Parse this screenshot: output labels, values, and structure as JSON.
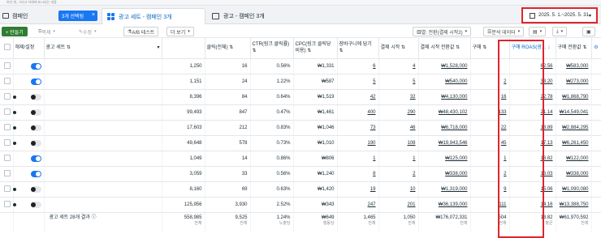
{
  "top_strip": "여기 위, 그리고 아래에 표시되는 내용",
  "tabs": {
    "campaign": "캠페인",
    "selected_chip": "3개 선택됨",
    "adset": "광고 세트 - 캠페인 3개",
    "ad": "광고 - 캠페인 3개"
  },
  "date_range": "2025. 5. 1.~2025. 5. 31.",
  "toolbar": {
    "create": "+ 만들기",
    "duplicate": "복제",
    "edit": "수정",
    "ab_test": "A/B 테스트",
    "more": "더 보기",
    "columns": "열: 전환(결제 시작2)",
    "breakdown": "분석 데이터"
  },
  "columns": {
    "toggle": "해제/설정",
    "name": "광고 세트",
    "clicks": "클릭(전체)",
    "ctr": "CTR(링크 클릭률)",
    "cpc": "CPC(링크 클릭당 비용)",
    "cart": "장바구니에 담기",
    "checkout": "결제 시작",
    "checkout_value": "결제 시작 전환값",
    "purchase": "구매",
    "roas": "구매 ROAS(광…",
    "purchase_value": "구매 전환값"
  },
  "rows": [
    {
      "on": true,
      "impressions": "1,250",
      "clicks": "16",
      "ctr": "0.56%",
      "cpc": "₩1,331",
      "cart": "6",
      "checkout": "4",
      "checkout_value": "₩1,528,000",
      "purchase": "",
      "roas": "62.56",
      "purchase_value": "₩583,000"
    },
    {
      "on": true,
      "impressions": "1,151",
      "clicks": "24",
      "ctr": "1.22%",
      "cpc": "₩587",
      "cart": "5",
      "checkout": "5",
      "checkout_value": "₩540,000",
      "purchase": "2",
      "roas": "33.20",
      "purchase_value": "₩273,000"
    },
    {
      "on": false,
      "impressions": "8,396",
      "clicks": "84",
      "ctr": "0.64%",
      "cpc": "₩1,519",
      "cart": "42",
      "checkout": "32",
      "checkout_value": "₩4,130,000",
      "purchase": "16",
      "roas": "22.78",
      "purchase_value": "₩1,868,790"
    },
    {
      "on": false,
      "impressions": "99,493",
      "clicks": "847",
      "ctr": "0.47%",
      "cpc": "₩1,461",
      "cart": "400",
      "checkout": "290",
      "checkout_value": "₩48,430,102",
      "purchase": "133",
      "roas": "21.14",
      "purchase_value": "₩14,549,041"
    },
    {
      "on": false,
      "impressions": "17,603",
      "clicks": "212",
      "ctr": "0.83%",
      "cpc": "₩1,046",
      "cart": "73",
      "checkout": "46",
      "checkout_value": "₩6,718,000",
      "purchase": "22",
      "roas": "18.89",
      "purchase_value": "₩2,884,295"
    },
    {
      "on": false,
      "impressions": "49,648",
      "clicks": "578",
      "ctr": "0.73%",
      "cpc": "₩1,010",
      "cart": "190",
      "checkout": "108",
      "checkout_value": "₩19,943,546",
      "purchase": "45",
      "roas": "17.13",
      "purchase_value": "₩6,261,450"
    },
    {
      "on": true,
      "impressions": "1,049",
      "clicks": "14",
      "ctr": "0.86%",
      "cpc": "₩806",
      "cart": "1",
      "checkout": "1",
      "checkout_value": "₩125,000",
      "purchase": "1",
      "roas": "16.82",
      "purchase_value": "₩122,000"
    },
    {
      "on": true,
      "impressions": "3,059",
      "clicks": "33",
      "ctr": "0.56%",
      "cpc": "₩1,240",
      "cart": "8",
      "checkout": "2",
      "checkout_value": "₩338,000",
      "purchase": "2",
      "roas": "16.03",
      "purchase_value": "₩338,000"
    },
    {
      "on": false,
      "impressions": "8,160",
      "clicks": "69",
      "ctr": "0.63%",
      "cpc": "₩1,420",
      "cart": "19",
      "checkout": "10",
      "checkout_value": "₩1,319,000",
      "purchase": "9",
      "roas": "15.06",
      "purchase_value": "₩1,090,080"
    },
    {
      "on": false,
      "impressions": "125,956",
      "clicks": "3,930",
      "ctr": "2.52%",
      "cpc": "₩343",
      "cart": "247",
      "checkout": "201",
      "checkout_value": "₩36,139,000",
      "purchase": "111",
      "roas": "14.16",
      "purchase_value": "₩13,388,750"
    }
  ],
  "totals": {
    "label": "광고 세트 28개 결과",
    "impressions": "558,985",
    "clicks": "9,525",
    "ctr": "1.24%",
    "cpc": "₩649",
    "cart": "1,465",
    "checkout": "1,050",
    "checkout_value": "₩176,072,331",
    "purchase": "504",
    "roas": "13.82",
    "purchase_value": "₩61,970,592",
    "sub_total": "전체",
    "sub_avg": "평균",
    "sub_per_imp": "노출당",
    "sub_per_person": "행동당"
  },
  "colors": {
    "accent": "#1877f2",
    "highlight": "#e0242c",
    "create": "#2e7d32"
  }
}
